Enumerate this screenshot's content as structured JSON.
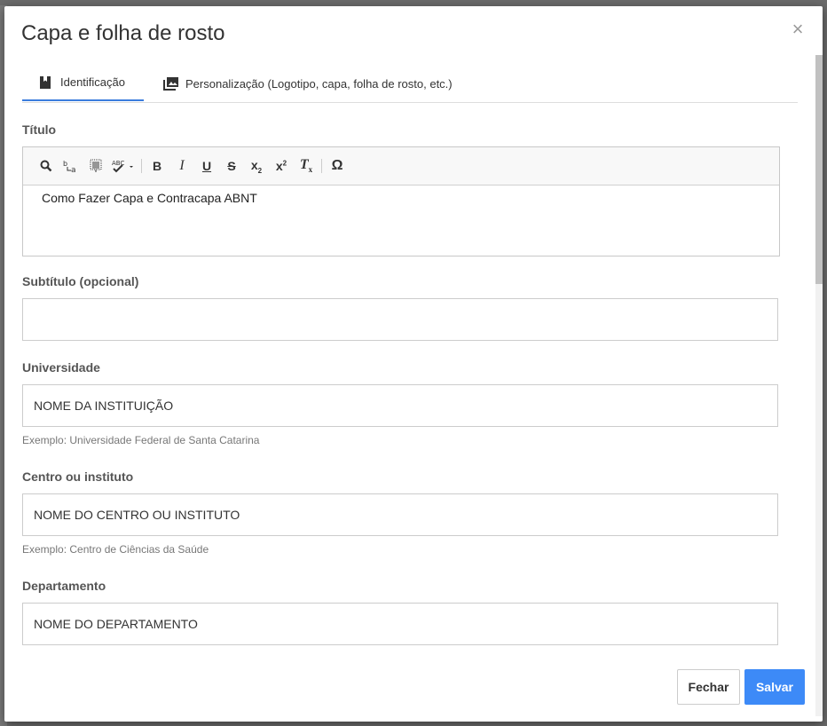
{
  "dialog": {
    "title": "Capa e folha de rosto",
    "close_symbol": "×"
  },
  "tabs": [
    {
      "label": "Identificação",
      "icon": "bookmark-icon",
      "active": true
    },
    {
      "label": "Personalização (Logotipo, capa, folha de rosto, etc.)",
      "icon": "images-icon",
      "active": false
    }
  ],
  "fields": {
    "titulo": {
      "label": "Título",
      "value": "Como Fazer Capa e Contracapa ABNT",
      "toolbar": [
        {
          "name": "find-icon",
          "glyph": "🔍"
        },
        {
          "name": "replace-icon",
          "glyph": "b→a"
        },
        {
          "name": "select-all-icon",
          "glyph": "▤"
        },
        {
          "name": "spellcheck-icon",
          "glyph": "ABC✓"
        },
        {
          "name": "bold-icon",
          "glyph": "B"
        },
        {
          "name": "italic-icon",
          "glyph": "I"
        },
        {
          "name": "underline-icon",
          "glyph": "U"
        },
        {
          "name": "strikethrough-icon",
          "glyph": "S"
        },
        {
          "name": "subscript-icon",
          "glyph": "x₂"
        },
        {
          "name": "superscript-icon",
          "glyph": "x²"
        },
        {
          "name": "remove-format-icon",
          "glyph": "Tx"
        },
        {
          "name": "special-char-icon",
          "glyph": "Ω"
        }
      ]
    },
    "subtitulo": {
      "label": "Subtítulo (opcional)",
      "value": ""
    },
    "universidade": {
      "label": "Universidade",
      "value": "NOME DA INSTITUIÇÃO",
      "hint": "Exemplo: Universidade Federal de Santa Catarina"
    },
    "centro": {
      "label": "Centro ou instituto",
      "value": "NOME DO CENTRO OU INSTITUTO",
      "hint": "Exemplo: Centro de Ciências da Saúde"
    },
    "departamento": {
      "label": "Departamento",
      "value": "NOME DO DEPARTAMENTO"
    }
  },
  "buttons": {
    "close_label": "Fechar",
    "save_label": "Salvar"
  },
  "colors": {
    "accent": "#3b7ddd",
    "save_button": "#3d8af7"
  }
}
